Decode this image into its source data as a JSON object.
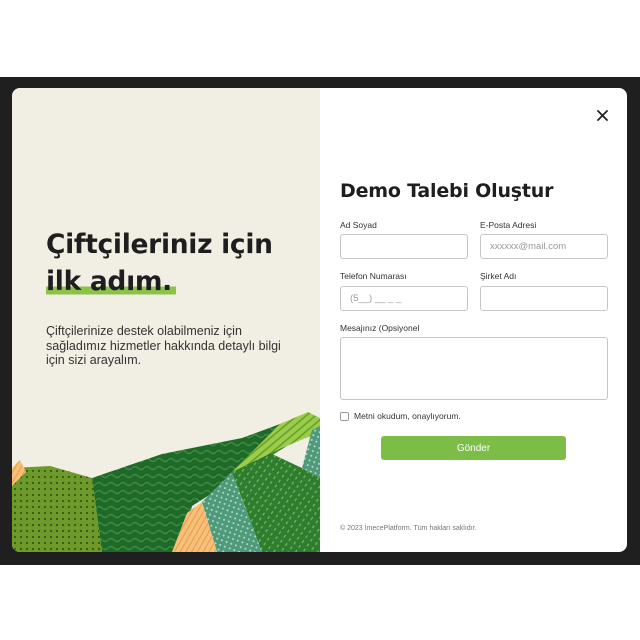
{
  "hero": {
    "title_line1": "Çiftçileriniz için",
    "title_line2": "ilk adım.",
    "description": "Çiftçilerinize destek olabilmeniz için sağladımız hizmetler hakkında detaylı bilgi için sizi arayalım."
  },
  "form": {
    "title": "Demo Talebi Oluştur",
    "fields": {
      "name": {
        "label": "Ad Soyad",
        "placeholder": ""
      },
      "email": {
        "label": "E-Posta Adresi",
        "placeholder": "xxxxxx@mail.com"
      },
      "phone": {
        "label": "Telefon Numarası",
        "placeholder": "(5__) __ _ _"
      },
      "company": {
        "label": "Şirket Adı",
        "placeholder": ""
      },
      "message": {
        "label": "Mesajınız (Opsiyonel",
        "placeholder": ""
      }
    },
    "consent_label": "Metni okudum, onaylıyorum.",
    "submit_label": "Gönder",
    "footer": "© 2023 İmecePlatform. Tüm hakları saklıdır."
  },
  "icons": {
    "close": "close-icon"
  },
  "colors": {
    "accent": "#7cbd48",
    "panel_bg": "#f1eee3"
  }
}
